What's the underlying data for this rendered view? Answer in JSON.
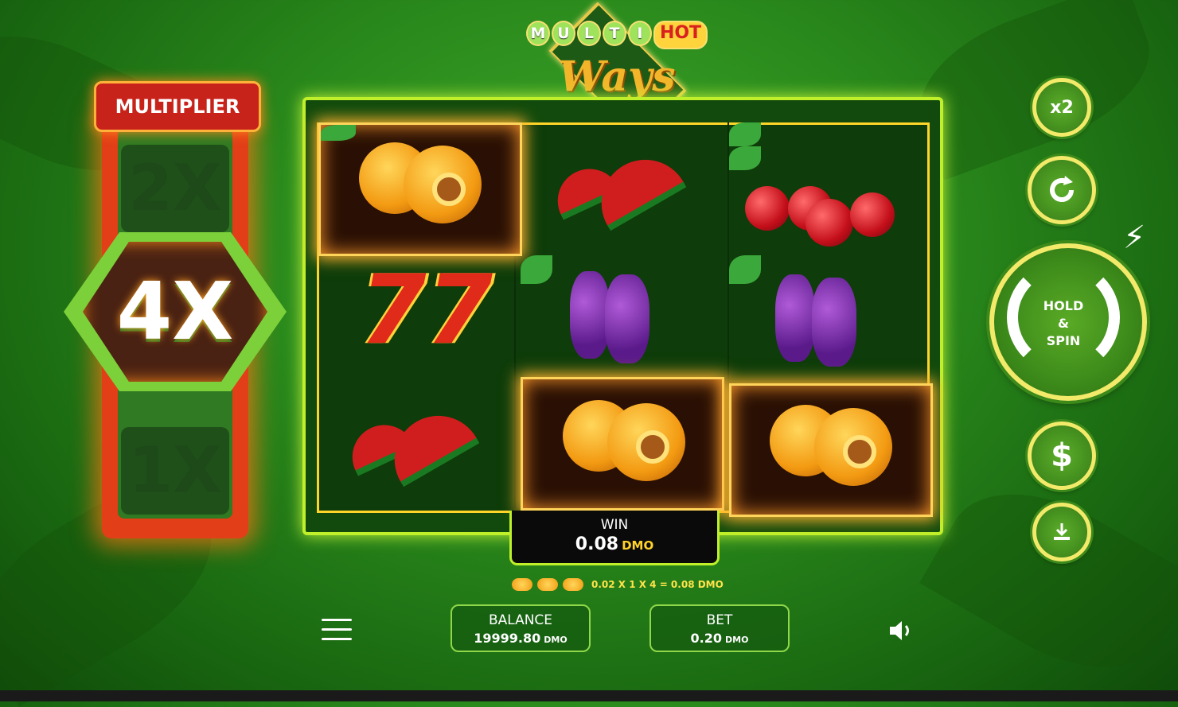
{
  "game": {
    "logo_letters": [
      "M",
      "U",
      "L",
      "T",
      "I"
    ],
    "logo_hot": "HOT",
    "logo_ways": "Ways"
  },
  "multiplier": {
    "title": "MULTIPLIER",
    "upper": "2X",
    "active": "4X",
    "lower": "1X"
  },
  "reels": {
    "columns": [
      [
        "apricot",
        "seven",
        "watermelon"
      ],
      [
        "watermelon",
        "grapes",
        "apricot"
      ],
      [
        "cherry",
        "grapes",
        "apricot"
      ]
    ],
    "winning_symbol": "apricot"
  },
  "win": {
    "label": "WIN",
    "amount": "0.08",
    "currency": "DMO",
    "formula": "0.02 X 1 X 4 = 0.08 DMO"
  },
  "balance": {
    "label": "BALANCE",
    "amount": "19999.80",
    "currency": "DMO"
  },
  "bet": {
    "label": "BET",
    "amount": "0.20",
    "currency": "DMO"
  },
  "controls": {
    "double_label": "x2",
    "spin_line1": "HOLD",
    "spin_line2": "&",
    "spin_line3": "SPIN",
    "colors": {
      "accent": "#f3ea6a",
      "button": "#3c8a1a",
      "frame": "#bff02a"
    }
  }
}
